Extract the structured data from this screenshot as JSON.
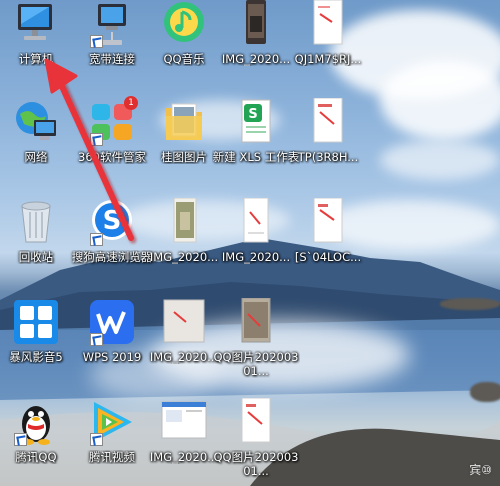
{
  "desktop": {
    "icons": [
      {
        "label": "计算机",
        "icon": "computer-icon"
      },
      {
        "label": "宽带连接",
        "icon": "broadband-icon"
      },
      {
        "label": "QQ音乐",
        "icon": "qq-music-icon"
      },
      {
        "label": "IMG_2020...",
        "icon": "image-file-icon"
      },
      {
        "label": "QJ1M7$RJ...",
        "icon": "image-file-icon"
      },
      {
        "label": "网络",
        "icon": "network-icon"
      },
      {
        "label": "360软件管家",
        "icon": "software-manager-icon"
      },
      {
        "label": "桂图图片",
        "icon": "folder-icon"
      },
      {
        "label": "新建 XLS 工作表",
        "icon": "excel-file-icon"
      },
      {
        "label": "TP(3R8H...",
        "icon": "image-file-icon"
      },
      {
        "label": "回收站",
        "icon": "recycle-bin-icon"
      },
      {
        "label": "搜狗高速浏览器",
        "icon": "sogou-browser-icon"
      },
      {
        "label": "IMG_2020...",
        "icon": "image-file-icon"
      },
      {
        "label": "IMG_2020...",
        "icon": "image-file-icon"
      },
      {
        "label": "[S`04LOC...",
        "icon": "image-file-icon"
      },
      {
        "label": "暴风影音5",
        "icon": "baofeng-player-icon"
      },
      {
        "label": "WPS 2019",
        "icon": "wps-icon"
      },
      {
        "label": "IMG_2020...",
        "icon": "image-file-icon"
      },
      {
        "label": "QQ图片20200301...",
        "icon": "image-file-icon"
      },
      {
        "label": "腾讯QQ",
        "icon": "qq-penguin-icon"
      },
      {
        "label": "腾讯视频",
        "icon": "tencent-video-icon"
      },
      {
        "label": "IMG_2020...",
        "icon": "image-file-icon"
      },
      {
        "label": "QQ图片20200301...",
        "icon": "image-file-icon"
      }
    ],
    "badge_count": "1"
  },
  "colors": {
    "arrow": "#e8333a",
    "label_text": "#ffffff",
    "accent_blue": "#1a6fd6"
  }
}
